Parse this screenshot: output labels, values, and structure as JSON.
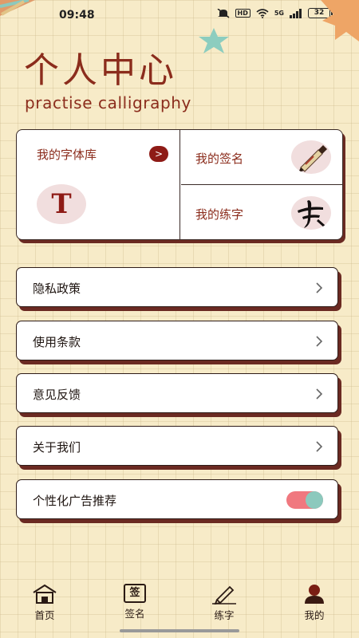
{
  "status_bar": {
    "time": "09:48",
    "network": "5G",
    "hd": "HD",
    "battery": "32"
  },
  "header": {
    "title": "个人中心",
    "subtitle": "practise calligraphy"
  },
  "feature_card": {
    "font_library": {
      "label": "我的字体库",
      "arrow": ">",
      "thumb_text": "T"
    },
    "signature": {
      "label": "我的签名"
    },
    "practice": {
      "label": "我的练字"
    }
  },
  "menu": {
    "items": [
      {
        "label": "隐私政策",
        "trailing": "chevron"
      },
      {
        "label": "使用条款",
        "trailing": "chevron"
      },
      {
        "label": "意见反馈",
        "trailing": "chevron"
      },
      {
        "label": "关于我们",
        "trailing": "chevron"
      },
      {
        "label": "个性化广告推荐",
        "trailing": "toggle",
        "toggle_on": true
      }
    ]
  },
  "bottom_nav": {
    "items": [
      {
        "label": "首页",
        "icon": "home-icon"
      },
      {
        "label": "签名",
        "icon": "signature-icon",
        "icon_text": "签"
      },
      {
        "label": "练字",
        "icon": "pen-icon"
      },
      {
        "label": "我的",
        "icon": "profile-icon",
        "active": true
      }
    ]
  },
  "colors": {
    "accent": "#8b2c1c",
    "background": "#f7ebc8",
    "card_shadow": "#6b2a22",
    "toggle_track": "#f0787f",
    "toggle_knob": "#8cc9bd"
  }
}
